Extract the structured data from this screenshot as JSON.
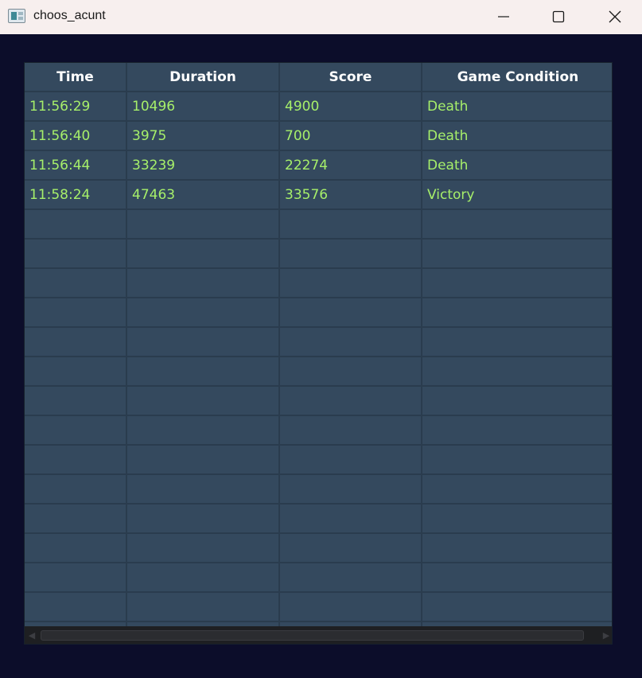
{
  "window": {
    "title": "choos_acunt",
    "icons": {
      "app": "app-window-icon",
      "minimize": "minimize-icon",
      "maximize": "maximize-icon",
      "close": "close-icon"
    }
  },
  "table": {
    "columns": [
      "Time",
      "Duration",
      "Score",
      "Game Condition"
    ],
    "rows": [
      [
        "11:56:29",
        "10496",
        "4900",
        "Death"
      ],
      [
        "11:56:40",
        "3975",
        "700",
        "Death"
      ],
      [
        "11:56:44",
        "33239",
        "22274",
        "Death"
      ],
      [
        "11:58:24",
        "47463",
        "33576",
        "Victory"
      ]
    ],
    "empty_row_count": 15
  },
  "colors": {
    "background": "#0c0d2a",
    "cell": "#34495e",
    "grid_line": "#2a3c4e",
    "header_text": "#ffffff",
    "value_text": "#a6ef6a"
  }
}
